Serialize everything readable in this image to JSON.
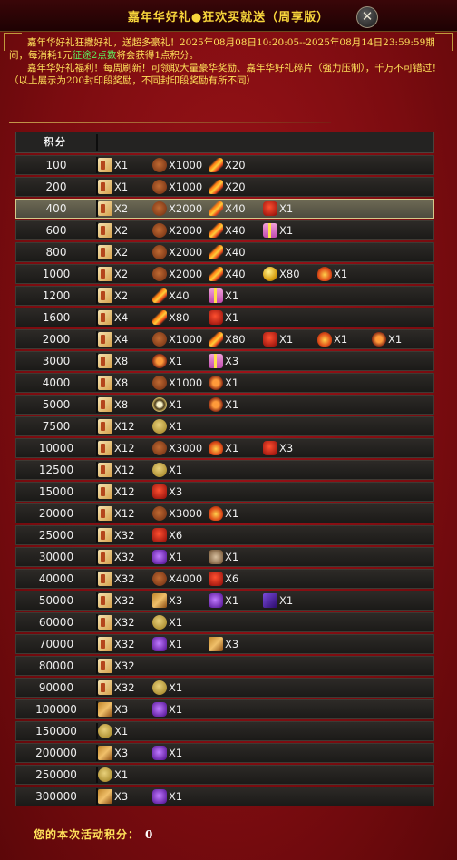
{
  "window": {
    "title": "嘉年华好礼●狂欢买就送（周享版）",
    "close_label": "✕"
  },
  "description": {
    "line1": "嘉年华好礼狂撒好礼，送超多豪礼！2025年08月08日10:20:05--2025年08月14日23:59:59期间，每消耗1元",
    "line1_green": "征途2点数",
    "line1_tail": "将会获得1点积分。",
    "line2": "嘉年华好礼福利！每周刷新！可领取大量豪华奖励、嘉年华好礼碎片（强力压制），千万不可错过！",
    "line3": "（以上展示为200封印段奖励，不同封印段奖励有所不同）"
  },
  "table": {
    "header": "积分",
    "rows": [
      {
        "score": "100",
        "rewards": [
          {
            "icon": "scroll-icon",
            "count": "X1"
          },
          {
            "icon": "ore-icon",
            "count": "X1000"
          },
          {
            "icon": "feather-icon",
            "count": "X20"
          }
        ]
      },
      {
        "score": "200",
        "rewards": [
          {
            "icon": "scroll-icon",
            "count": "X1"
          },
          {
            "icon": "ore-icon",
            "count": "X1000"
          },
          {
            "icon": "feather-icon",
            "count": "X20"
          }
        ]
      },
      {
        "score": "400",
        "selected": true,
        "rewards": [
          {
            "icon": "scroll-icon",
            "count": "X2"
          },
          {
            "icon": "ore-icon",
            "count": "X2000"
          },
          {
            "icon": "feather-icon",
            "count": "X40"
          },
          {
            "icon": "red-box-icon",
            "count": "X1"
          }
        ]
      },
      {
        "score": "600",
        "rewards": [
          {
            "icon": "scroll-icon",
            "count": "X2"
          },
          {
            "icon": "ore-icon",
            "count": "X2000"
          },
          {
            "icon": "feather-icon",
            "count": "X40"
          },
          {
            "icon": "gift-icon",
            "count": "X1"
          }
        ]
      },
      {
        "score": "800",
        "rewards": [
          {
            "icon": "scroll-icon",
            "count": "X2"
          },
          {
            "icon": "ore-icon",
            "count": "X2000"
          },
          {
            "icon": "feather-icon",
            "count": "X40"
          }
        ]
      },
      {
        "score": "1000",
        "rewards": [
          {
            "icon": "scroll-icon",
            "count": "X2"
          },
          {
            "icon": "ore-icon",
            "count": "X2000"
          },
          {
            "icon": "feather-icon",
            "count": "X40"
          },
          {
            "icon": "coin-icon",
            "count": "X80"
          },
          {
            "icon": "flame-icon",
            "count": "X1"
          }
        ]
      },
      {
        "score": "1200",
        "rewards": [
          {
            "icon": "scroll-icon",
            "count": "X2"
          },
          {
            "icon": "feather-icon",
            "count": "X40"
          },
          {
            "icon": "gift-icon",
            "count": "X1"
          }
        ]
      },
      {
        "score": "1600",
        "rewards": [
          {
            "icon": "scroll-icon",
            "count": "X4"
          },
          {
            "icon": "feather-icon",
            "count": "X80"
          },
          {
            "icon": "red-box-icon",
            "count": "X1"
          }
        ]
      },
      {
        "score": "2000",
        "rewards": [
          {
            "icon": "scroll-icon",
            "count": "X4"
          },
          {
            "icon": "ore-icon",
            "count": "X1000"
          },
          {
            "icon": "feather-icon",
            "count": "X80"
          },
          {
            "icon": "red-box-icon",
            "count": "X1"
          },
          {
            "icon": "flame-icon",
            "count": "X1"
          },
          {
            "icon": "sun-icon",
            "count": "X1"
          }
        ]
      },
      {
        "score": "3000",
        "rewards": [
          {
            "icon": "scroll-icon",
            "count": "X8"
          },
          {
            "icon": "sun-icon",
            "count": "X1"
          },
          {
            "icon": "gift-icon",
            "count": "X3"
          }
        ]
      },
      {
        "score": "4000",
        "rewards": [
          {
            "icon": "scroll-icon",
            "count": "X8"
          },
          {
            "icon": "ore-icon",
            "count": "X1000"
          },
          {
            "icon": "sun-icon",
            "count": "X1"
          }
        ]
      },
      {
        "score": "5000",
        "rewards": [
          {
            "icon": "scroll-icon",
            "count": "X8"
          },
          {
            "icon": "eye-icon",
            "count": "X1"
          },
          {
            "icon": "sun-icon",
            "count": "X1"
          }
        ]
      },
      {
        "score": "7500",
        "rewards": [
          {
            "icon": "scroll-icon",
            "count": "X12"
          },
          {
            "icon": "gourd-icon",
            "count": "X1"
          }
        ]
      },
      {
        "score": "10000",
        "rewards": [
          {
            "icon": "scroll-icon",
            "count": "X12"
          },
          {
            "icon": "ore-icon",
            "count": "X3000"
          },
          {
            "icon": "flame-icon",
            "count": "X1"
          },
          {
            "icon": "red-box-icon",
            "count": "X3"
          }
        ]
      },
      {
        "score": "12500",
        "rewards": [
          {
            "icon": "scroll-icon",
            "count": "X12"
          },
          {
            "icon": "gourd-icon",
            "count": "X1"
          }
        ]
      },
      {
        "score": "15000",
        "rewards": [
          {
            "icon": "scroll-icon",
            "count": "X12"
          },
          {
            "icon": "red-box-icon",
            "count": "X3"
          }
        ]
      },
      {
        "score": "20000",
        "rewards": [
          {
            "icon": "scroll-icon",
            "count": "X12"
          },
          {
            "icon": "ore-icon",
            "count": "X3000"
          },
          {
            "icon": "flame-icon",
            "count": "X1"
          }
        ]
      },
      {
        "score": "25000",
        "rewards": [
          {
            "icon": "scroll-icon",
            "count": "X32"
          },
          {
            "icon": "red-box-icon",
            "count": "X6"
          }
        ]
      },
      {
        "score": "30000",
        "rewards": [
          {
            "icon": "scroll-icon",
            "count": "X32"
          },
          {
            "icon": "purple-orb-icon",
            "count": "X1"
          },
          {
            "icon": "beast-icon",
            "count": "X1"
          }
        ]
      },
      {
        "score": "40000",
        "rewards": [
          {
            "icon": "scroll-icon",
            "count": "X32"
          },
          {
            "icon": "ore-icon",
            "count": "X4000"
          },
          {
            "icon": "red-box-icon",
            "count": "X6"
          }
        ]
      },
      {
        "score": "50000",
        "rewards": [
          {
            "icon": "scroll-icon",
            "count": "X32"
          },
          {
            "icon": "card-icon",
            "count": "X3"
          },
          {
            "icon": "purple-orb-icon",
            "count": "X1"
          },
          {
            "icon": "book-icon",
            "count": "X1"
          }
        ]
      },
      {
        "score": "60000",
        "rewards": [
          {
            "icon": "scroll-icon",
            "count": "X32"
          },
          {
            "icon": "gourd-icon",
            "count": "X1"
          }
        ]
      },
      {
        "score": "70000",
        "rewards": [
          {
            "icon": "scroll-icon",
            "count": "X32"
          },
          {
            "icon": "purple-orb-icon",
            "count": "X1"
          },
          {
            "icon": "card-icon",
            "count": "X3"
          }
        ]
      },
      {
        "score": "80000",
        "rewards": [
          {
            "icon": "scroll-icon",
            "count": "X32"
          }
        ]
      },
      {
        "score": "90000",
        "rewards": [
          {
            "icon": "scroll-icon",
            "count": "X32"
          },
          {
            "icon": "gourd-icon",
            "count": "X1"
          }
        ]
      },
      {
        "score": "100000",
        "rewards": [
          {
            "icon": "card-icon",
            "count": "X3"
          },
          {
            "icon": "purple-orb-icon",
            "count": "X1"
          }
        ]
      },
      {
        "score": "150000",
        "rewards": [
          {
            "icon": "gourd-icon",
            "count": "X1"
          }
        ]
      },
      {
        "score": "200000",
        "rewards": [
          {
            "icon": "card-icon",
            "count": "X3"
          },
          {
            "icon": "purple-orb-icon",
            "count": "X1"
          }
        ]
      },
      {
        "score": "250000",
        "rewards": [
          {
            "icon": "gourd-icon",
            "count": "X1"
          }
        ]
      },
      {
        "score": "300000",
        "rewards": [
          {
            "icon": "card-icon",
            "count": "X3"
          },
          {
            "icon": "purple-orb-icon",
            "count": "X1"
          }
        ]
      }
    ]
  },
  "footer": {
    "label": "您的本次活动积分：",
    "value": "0"
  }
}
